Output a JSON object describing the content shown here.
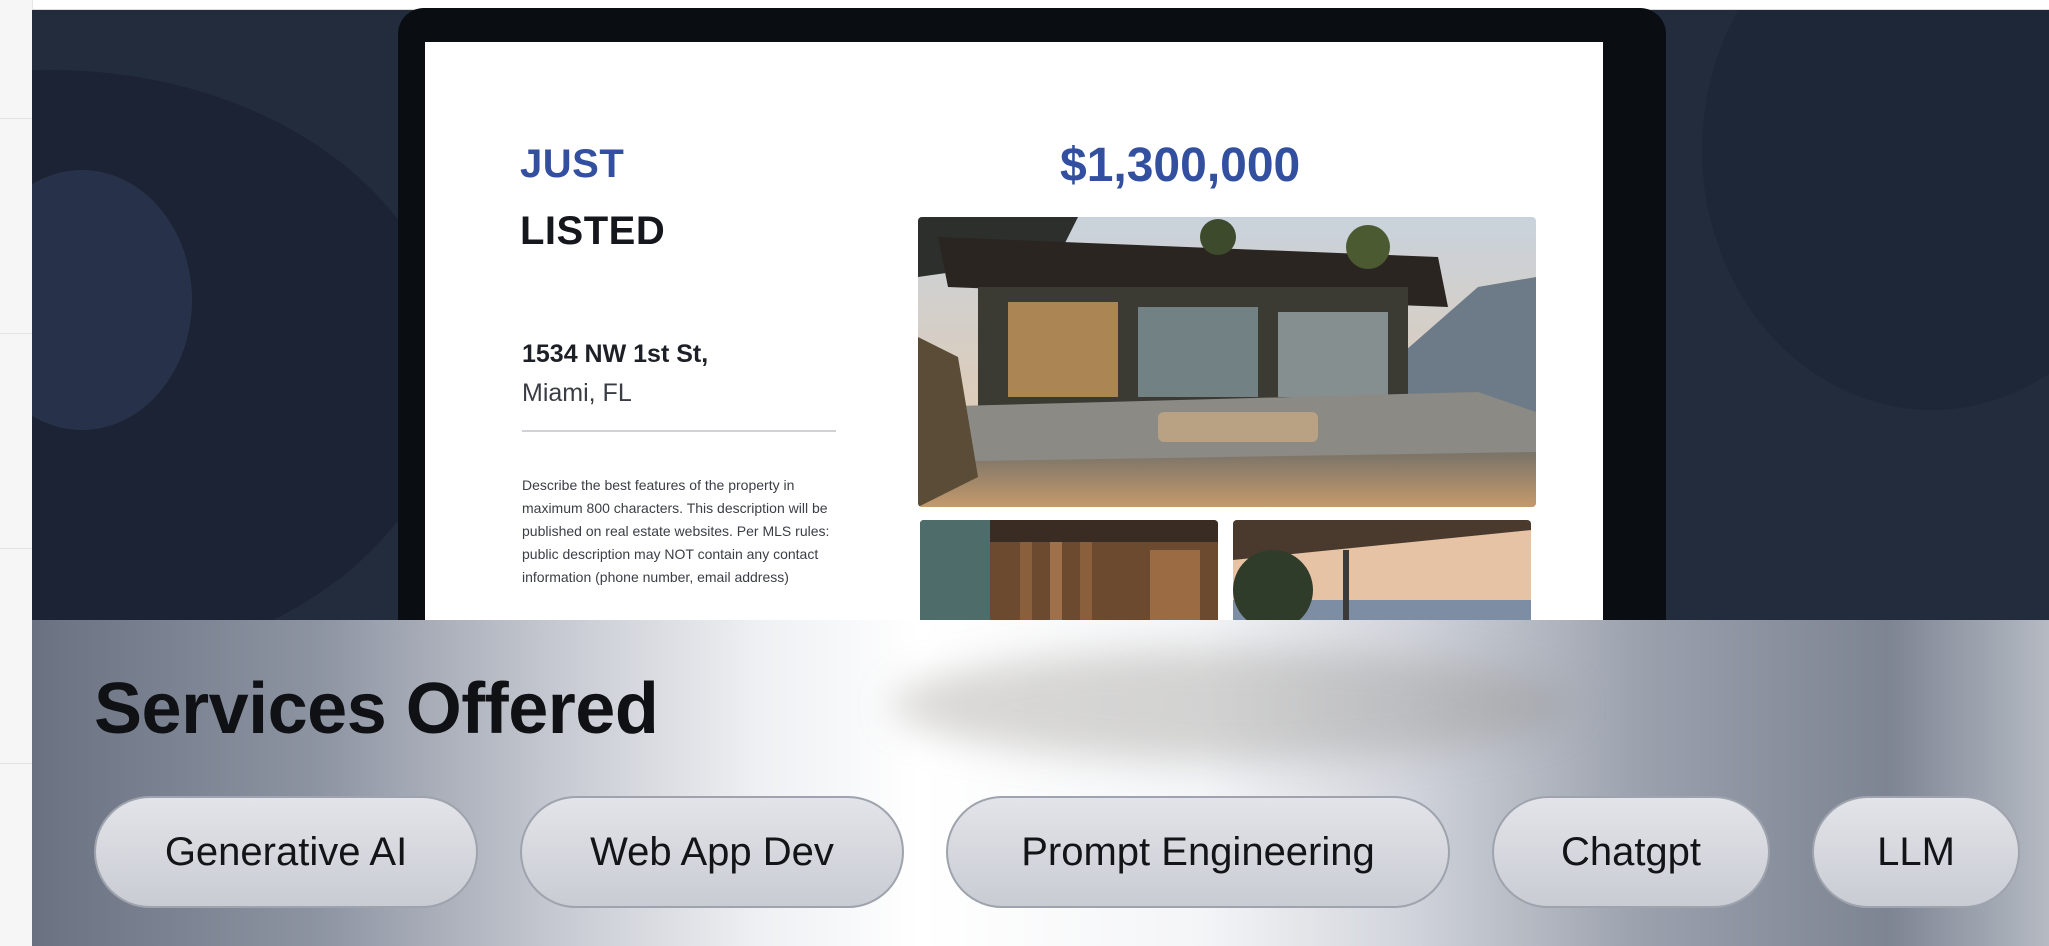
{
  "flyer": {
    "headline_1": "JUST",
    "headline_2": "LISTED",
    "price": "$1,300,000",
    "address_line_1": "1534 NW 1st St,",
    "address_line_2": "Miami, FL",
    "description": "Describe the best features of the property in maximum 800 characters. This description will be published on real estate websites. Per MLS rules: public description may NOT contain any contact information (phone number, email address)",
    "accent_color": "#3350a0"
  },
  "services": {
    "title": "Services Offered",
    "tags": [
      "Generative AI",
      "Web App Dev",
      "Prompt Engineering",
      "Chatgpt",
      "LLM"
    ]
  },
  "colors": {
    "hero_background": "#232c3c",
    "pill_background": "#d4d6dc"
  }
}
